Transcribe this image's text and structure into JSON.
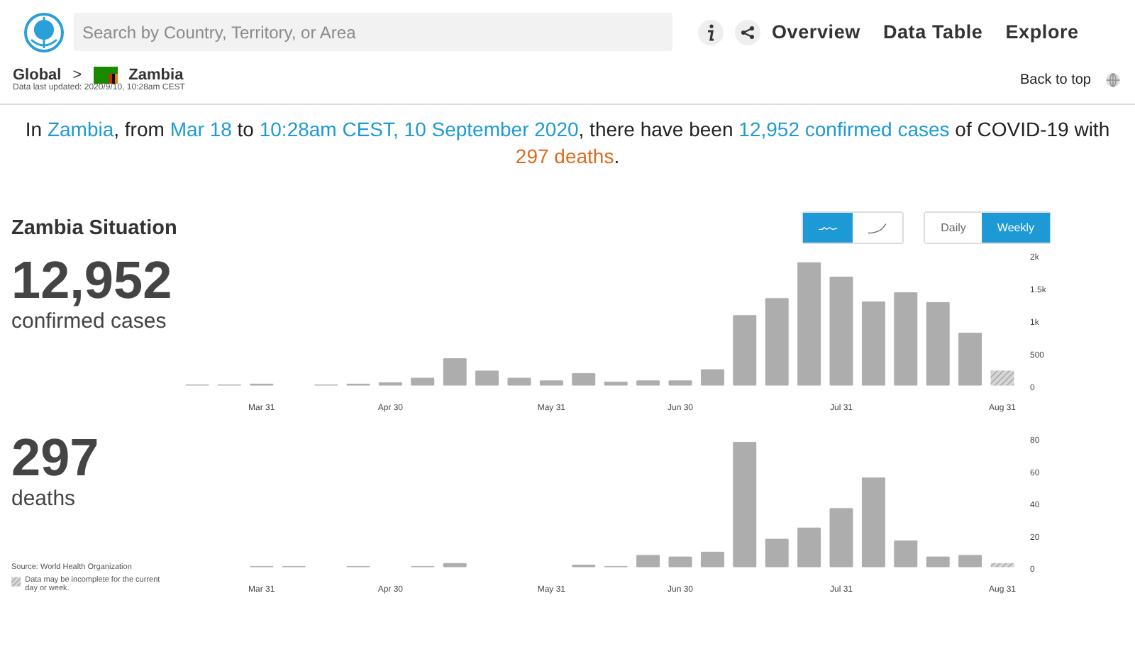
{
  "search": {
    "placeholder": "Search by Country, Territory, or Area"
  },
  "nav": [
    {
      "label": "Overview"
    },
    {
      "label": "Data Table"
    },
    {
      "label": "Explore"
    }
  ],
  "breadcrumb": {
    "parent": "Global",
    "separator": ">",
    "country": "Zambia",
    "updated": "Data last updated: 2020/9/10, 10:28am CEST"
  },
  "back_to_top": "Back to top",
  "headline": [
    {
      "kind": "plain",
      "text": "In "
    },
    {
      "kind": "highlight",
      "text": "Zambia"
    },
    {
      "kind": "plain",
      "text": ", from "
    },
    {
      "kind": "highlight",
      "text": "Mar 18"
    },
    {
      "kind": "plain",
      "text": " to "
    },
    {
      "kind": "highlight",
      "text": "10:28am CEST, 10 September 2020"
    },
    {
      "kind": "plain",
      "text": ", there have been "
    },
    {
      "kind": "highlight",
      "text": "12,952 confirmed cases"
    },
    {
      "kind": "plain",
      "text": " of COVID-19 with "
    },
    {
      "kind": "alert",
      "text": "297 deaths"
    },
    {
      "kind": "plain",
      "text": "."
    }
  ],
  "situation": {
    "title": "Zambia Situation",
    "chart_modes": [
      {
        "kind": "new",
        "selected": true
      },
      {
        "kind": "cumulative",
        "selected": false
      }
    ],
    "periods": [
      {
        "label": "Daily",
        "selected": false
      },
      {
        "label": "Weekly",
        "selected": true
      }
    ]
  },
  "panels": [
    {
      "total": "12,952",
      "label": "confirmed cases",
      "chart_data": {
        "type": "bar",
        "categories": [
          null,
          null,
          "Mar 31",
          null,
          null,
          null,
          "Apr 30",
          null,
          null,
          null,
          null,
          "May 31",
          null,
          null,
          null,
          "Jun 30",
          null,
          null,
          null,
          null,
          "Jul 31",
          null,
          null,
          null,
          null,
          "Aug 31"
        ],
        "values": [
          20,
          20,
          40,
          null,
          20,
          40,
          60,
          130,
          430,
          240,
          130,
          90,
          200,
          70,
          90,
          90,
          260,
          1090,
          1350,
          1900,
          1680,
          1300,
          1440,
          1290,
          820,
          240
        ],
        "ylim": [
          0,
          2000
        ],
        "yticks": [
          {
            "value": 0,
            "label": "0"
          },
          {
            "value": 500,
            "label": "500"
          },
          {
            "value": 1000,
            "label": "1k"
          },
          {
            "value": 1500,
            "label": "1.5k"
          },
          {
            "value": 2000,
            "label": "2k"
          }
        ]
      },
      "incomplete_last": true
    },
    {
      "total": "297",
      "label": "deaths",
      "chart_data": {
        "type": "bar",
        "categories": [
          null,
          null,
          "Mar 31",
          null,
          null,
          null,
          "Apr 30",
          null,
          null,
          null,
          null,
          "May 31",
          null,
          null,
          null,
          "Jun 30",
          null,
          null,
          null,
          null,
          "Jul 31",
          null,
          null,
          null,
          null,
          "Aug 31"
        ],
        "values": [
          null,
          null,
          1,
          1,
          null,
          1,
          null,
          1,
          3,
          null,
          null,
          null,
          2,
          1,
          8,
          7,
          10,
          78,
          18,
          25,
          37,
          56,
          17,
          7,
          8,
          3
        ],
        "ylim": [
          0,
          80
        ],
        "yticks": [
          {
            "value": 0,
            "label": "0"
          },
          {
            "value": 20,
            "label": "20"
          },
          {
            "value": 40,
            "label": "40"
          },
          {
            "value": 60,
            "label": "60"
          },
          {
            "value": 80,
            "label": "80"
          }
        ]
      },
      "incomplete_last": true
    }
  ],
  "source": "Source: World Health Organization",
  "legend": "Data may be incomplete for the current day or week."
}
